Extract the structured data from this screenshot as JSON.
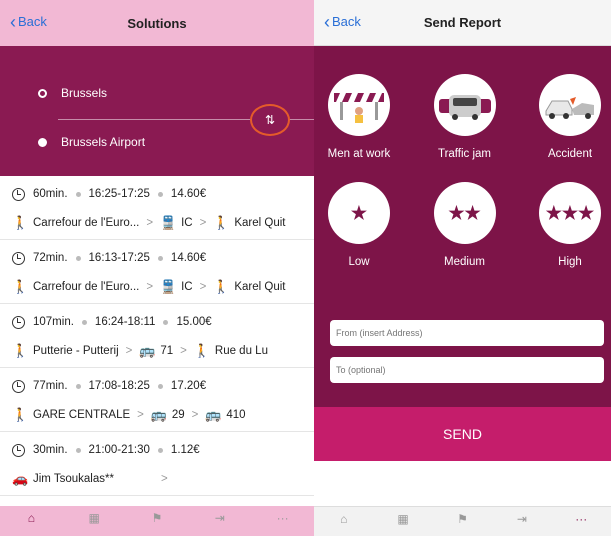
{
  "left": {
    "nav": {
      "back": "Back",
      "title": "Solutions"
    },
    "route": {
      "from": "Brussels",
      "to": "Brussels Airport",
      "swap_glyph": "⇅"
    },
    "trips": [
      {
        "duration": "60min.",
        "time": "16:25-17:25",
        "price": "14.60€",
        "steps": [
          {
            "icon": "walk-icon",
            "glyph": "🚶",
            "text": "Carrefour de l'Euro..."
          },
          {
            "icon": "train-icon",
            "glyph": "🚆",
            "text": "IC"
          },
          {
            "icon": "walk-icon",
            "glyph": "🚶",
            "text": "Karel Quit"
          }
        ]
      },
      {
        "duration": "72min.",
        "time": "16:13-17:25",
        "price": "14.60€",
        "steps": [
          {
            "icon": "walk-icon",
            "glyph": "🚶",
            "text": "Carrefour de l'Euro..."
          },
          {
            "icon": "train-icon",
            "glyph": "🚆",
            "text": "IC"
          },
          {
            "icon": "walk-icon",
            "glyph": "🚶",
            "text": "Karel Quit"
          }
        ]
      },
      {
        "duration": "107min.",
        "time": "16:24-18:11",
        "price": "15.00€",
        "steps": [
          {
            "icon": "walk-icon",
            "glyph": "🚶",
            "text": "Putterie - Putterij"
          },
          {
            "icon": "bus-icon",
            "glyph": "🚌",
            "text": "71"
          },
          {
            "icon": "walk-icon",
            "glyph": "🚶",
            "text": "Rue du Lu"
          }
        ]
      },
      {
        "duration": "77min.",
        "time": "17:08-18:25",
        "price": "17.20€",
        "steps": [
          {
            "icon": "walk-icon",
            "glyph": "🚶",
            "text": "GARE CENTRALE"
          },
          {
            "icon": "bus-icon",
            "glyph": "🚌",
            "text": "29"
          },
          {
            "icon": "bus-icon",
            "glyph": "🚌",
            "text": "410"
          }
        ]
      },
      {
        "duration": "30min.",
        "time": "21:00-21:30",
        "price": "1.12€",
        "steps": [
          {
            "icon": "car-icon",
            "glyph": "🚗",
            "text": "Jim Tsoukalas**"
          }
        ]
      }
    ],
    "tabs": [
      {
        "name": "home",
        "glyph": "⌂",
        "active": true
      },
      {
        "name": "trips",
        "glyph": "▦",
        "active": false
      },
      {
        "name": "report",
        "glyph": "⚑",
        "active": false
      },
      {
        "name": "login",
        "glyph": "⇥",
        "active": false
      },
      {
        "name": "more",
        "glyph": "···",
        "active": false
      }
    ]
  },
  "right": {
    "nav": {
      "back": "Back",
      "title": "Send Report"
    },
    "incidents": [
      {
        "label": "Men at work",
        "icon": "roadworks-icon"
      },
      {
        "label": "Traffic jam",
        "icon": "traffic-jam-icon"
      },
      {
        "label": "Accident",
        "icon": "car-crash-icon"
      }
    ],
    "severity": [
      {
        "label": "Low",
        "stars": "★"
      },
      {
        "label": "Medium",
        "stars": "★★"
      },
      {
        "label": "High",
        "stars": "★★★"
      }
    ],
    "from_placeholder": "From (insert Address)",
    "to_placeholder": "To (optional)",
    "send_label": "SEND",
    "tabs": [
      {
        "name": "home",
        "glyph": "⌂",
        "active": false
      },
      {
        "name": "trips",
        "glyph": "▦",
        "active": false
      },
      {
        "name": "report",
        "glyph": "⚑",
        "active": false
      },
      {
        "name": "login",
        "glyph": "⇥",
        "active": false
      },
      {
        "name": "more",
        "glyph": "···",
        "active": true
      }
    ]
  },
  "colors": {
    "brand": "#8a1a52",
    "accent": "#c51d6b",
    "pink_bar": "#f2b8d4",
    "link": "#2a6fd6"
  }
}
